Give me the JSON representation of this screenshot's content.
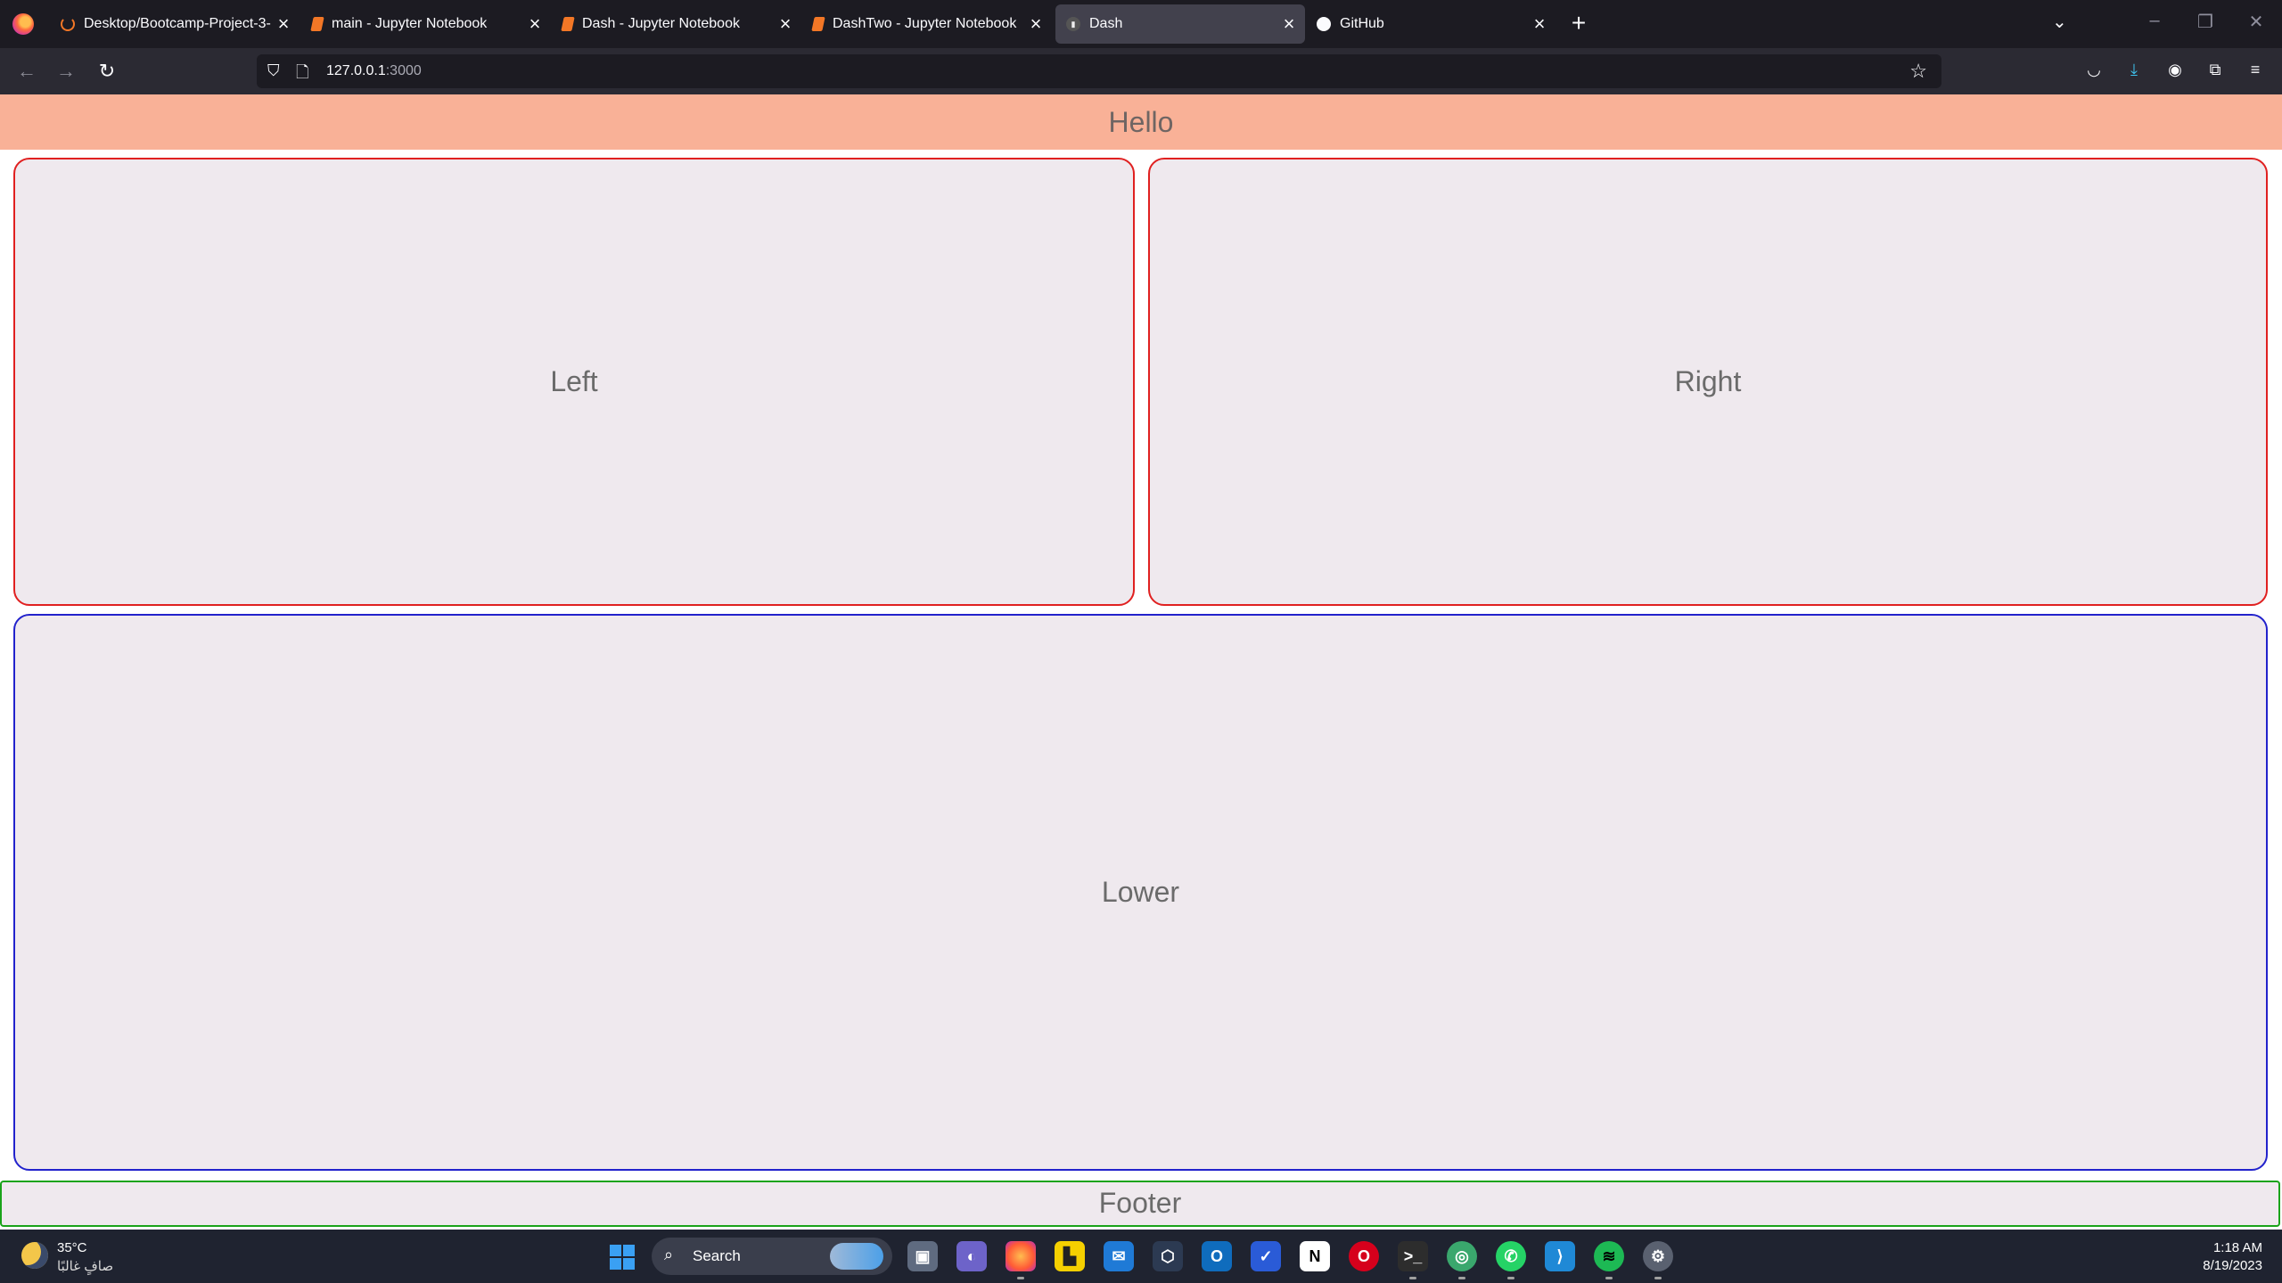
{
  "browser": {
    "tabs": [
      {
        "title": "Desktop/Bootcamp-Project-3-",
        "icon": "loading-ring-icon",
        "active": false
      },
      {
        "title": "main - Jupyter Notebook",
        "icon": "jupyter-icon",
        "active": false
      },
      {
        "title": "Dash - Jupyter Notebook",
        "icon": "jupyter-icon",
        "active": false
      },
      {
        "title": "DashTwo - Jupyter Notebook",
        "icon": "jupyter-icon",
        "active": false
      },
      {
        "title": "Dash",
        "icon": "dash-icon",
        "active": true
      },
      {
        "title": "GitHub",
        "icon": "github-icon",
        "active": false
      }
    ],
    "url_host": "127.0.0.1",
    "url_port": ":3000"
  },
  "page": {
    "header": "Hello",
    "left": "Left",
    "right": "Right",
    "lower": "Lower",
    "footer": "Footer"
  },
  "taskbar": {
    "weather_temp": "35°C",
    "weather_condition": "صافٍ غالبًا",
    "search_placeholder": "Search",
    "time": "1:18 AM",
    "date": "8/19/2023",
    "apps": [
      "task-view",
      "teams",
      "firefox",
      "sticky-notes",
      "mail",
      "3d-viewer",
      "outlook",
      "todo",
      "notion",
      "opera",
      "terminal",
      "maps",
      "whatsapp",
      "vscode",
      "spotify",
      "settings"
    ]
  },
  "colors": {
    "header_bg": "#f9b197",
    "panel_border_top": "#e02020",
    "panel_border_lower": "#2222cc",
    "footer_border": "#1aa31a",
    "panel_bg": "#efe9ee"
  }
}
